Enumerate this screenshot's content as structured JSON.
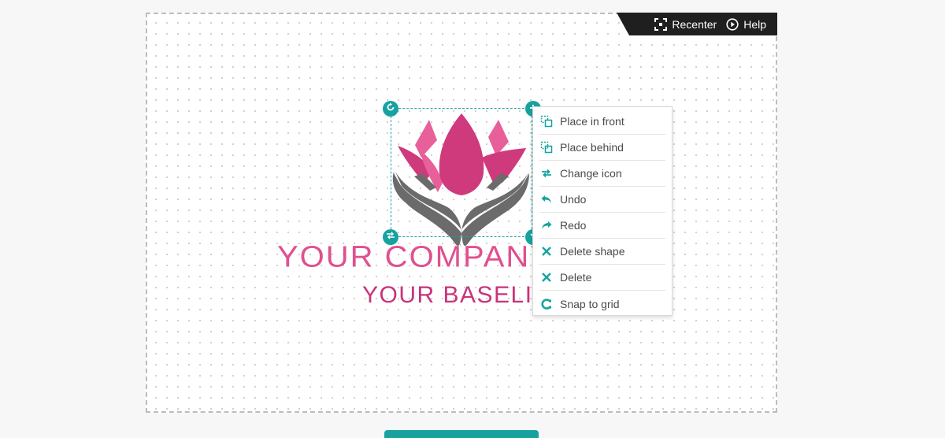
{
  "toolbar": {
    "recenter_label": "Recenter",
    "help_label": "Help"
  },
  "logo": {
    "company_name": "YOUR COMPANY",
    "baseline": "YOUR BASELI",
    "colors": {
      "petal_dark": "#cf3a7c",
      "petal_light": "#e8609a",
      "hands": "#6b6b6b",
      "company_text": "#e0508f",
      "baseline_text": "#c8347a"
    }
  },
  "context_menu": {
    "items": [
      {
        "label": "Place in front",
        "icon": "place-in-front-icon"
      },
      {
        "label": "Place behind",
        "icon": "place-behind-icon"
      },
      {
        "label": "Change icon",
        "icon": "swap-arrows-icon"
      },
      {
        "label": "Undo",
        "icon": "undo-icon"
      },
      {
        "label": "Redo",
        "icon": "redo-icon"
      },
      {
        "label": "Delete shape",
        "icon": "close-icon"
      },
      {
        "label": "Delete",
        "icon": "close-icon"
      },
      {
        "label": "Snap to grid",
        "icon": "magnet-icon"
      }
    ]
  },
  "theme": {
    "accent": "#17a2a0",
    "toolbar_bg": "#1f1f1f"
  }
}
